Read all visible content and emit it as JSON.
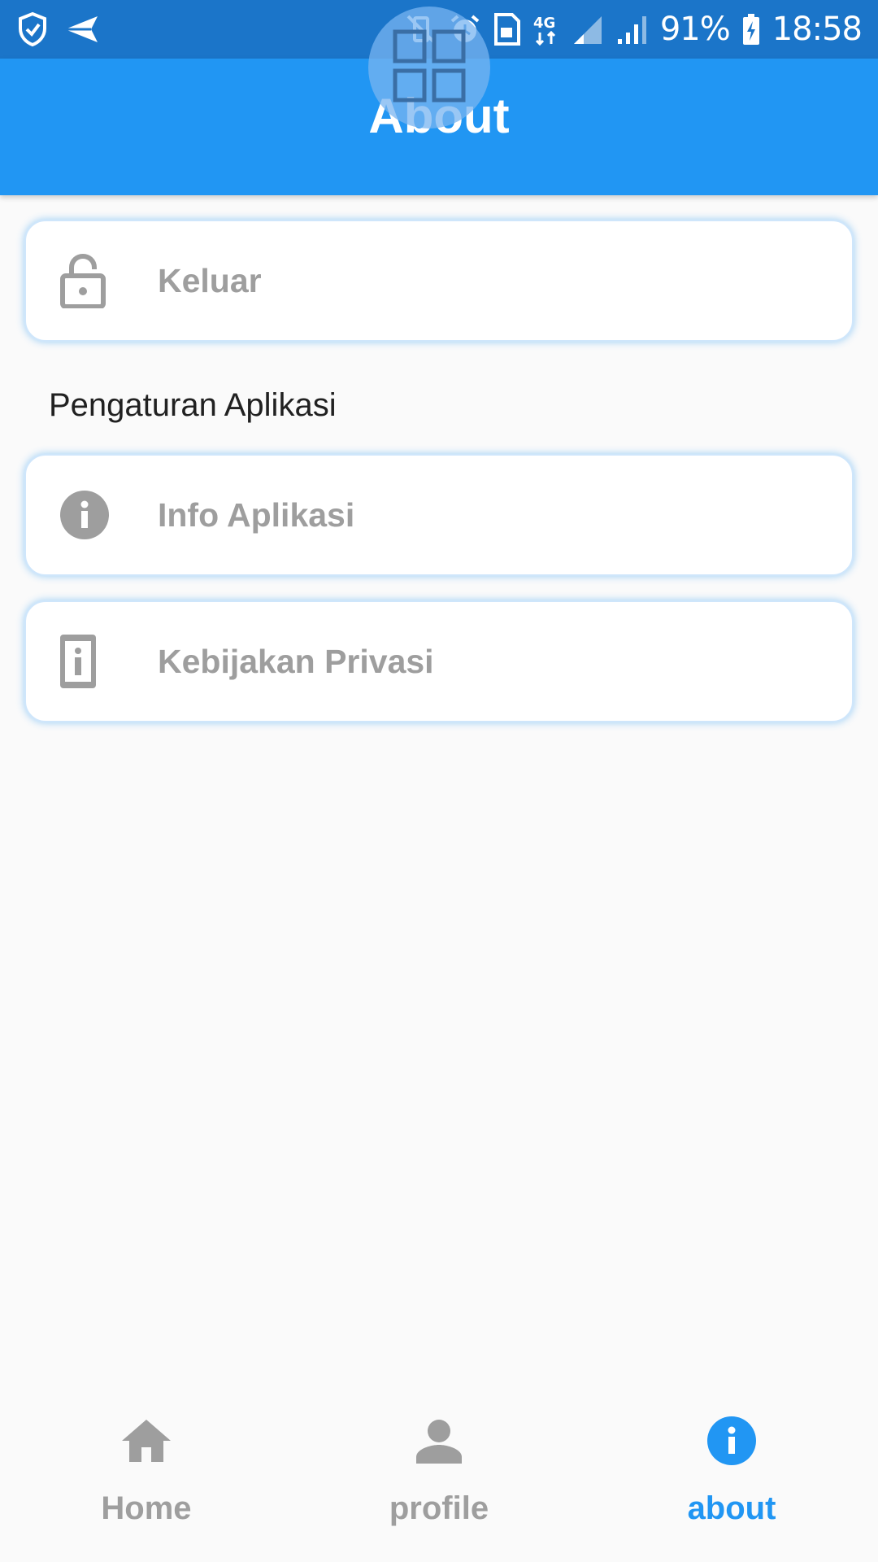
{
  "status_bar": {
    "battery": "91%",
    "time": "18:58",
    "network": "4G"
  },
  "app_bar": {
    "title": "About"
  },
  "cards": {
    "logout": {
      "label": "Keluar",
      "icon": "lock-icon"
    },
    "app_info": {
      "label": "Info Aplikasi",
      "icon": "info-icon"
    },
    "privacy": {
      "label": "Kebijakan Privasi",
      "icon": "privacy-document-icon"
    }
  },
  "section": {
    "title": "Pengaturan Aplikasi"
  },
  "bottom_nav": {
    "items": [
      {
        "label": "Home",
        "icon": "home-icon",
        "active": false
      },
      {
        "label": "profile",
        "icon": "person-icon",
        "active": false
      },
      {
        "label": "about",
        "icon": "info-icon",
        "active": true
      }
    ]
  },
  "colors": {
    "primary": "#2196f3",
    "status_bar": "#1b75c9",
    "inactive": "#9e9e9e"
  }
}
